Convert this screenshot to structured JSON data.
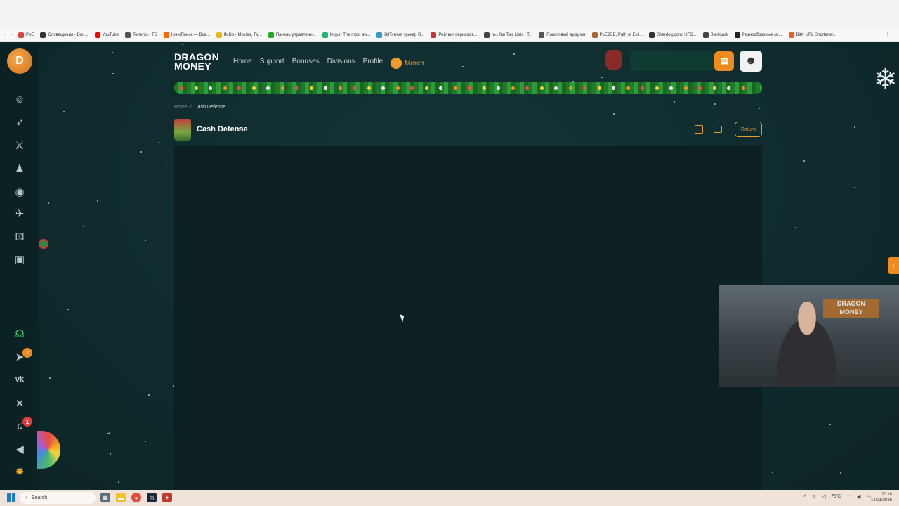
{
  "bookmarks": [
    {
      "label": "PoE",
      "color": "#d44"
    },
    {
      "label": "Оповещения - Don...",
      "color": "#333"
    },
    {
      "label": "YouTube",
      "color": "#f00"
    },
    {
      "label": "Torrents - TD",
      "color": "#555"
    },
    {
      "label": "КиноПоиск — Все...",
      "color": "#f60"
    },
    {
      "label": "IMDb - Movies, TV...",
      "color": "#e6b91e"
    },
    {
      "label": "Панель управлени...",
      "color": "#2a2"
    },
    {
      "label": "Imgur: The most aw...",
      "color": "#1bb76e"
    },
    {
      "label": "BitTorrent трекер R...",
      "color": "#39c"
    },
    {
      "label": "Рейтинг сериалов...",
      "color": "#c33"
    },
    {
      "label": "№1 fan Tier Lists - T...",
      "color": "#444"
    },
    {
      "label": "Политовый аукцион",
      "color": "#555"
    },
    {
      "label": "PoE2DB, Path of Exil...",
      "color": "#a63"
    },
    {
      "label": "Sherdog.com: UFC...",
      "color": "#333"
    },
    {
      "label": "Blackjack",
      "color": "#444"
    },
    {
      "label": "Разнообразные си...",
      "color": "#222"
    },
    {
      "label": "Bitly URL Shortener...",
      "color": "#ee6123"
    }
  ],
  "header": {
    "logo_line1": "DRAGON",
    "logo_line2": "MONEY",
    "nav": [
      "Home",
      "Support",
      "Bonuses",
      "Divisions",
      "Profile"
    ],
    "merch": "Merch",
    "wallet_icon": "wallet-icon",
    "avatar_icon": "avatar-icon"
  },
  "breadcrumb": {
    "home": "Home",
    "separator": "/",
    "current": "Cash Defense"
  },
  "game": {
    "title": "Cash Defense",
    "return_label": "Return"
  },
  "sidebar": {
    "icons": [
      "smile-icon",
      "rocket-icon",
      "crossed-swords-icon",
      "person-icon",
      "fire-icon",
      "plane-icon",
      "dice-icon",
      "gift-icon",
      "headset-icon",
      "telegram-icon",
      "vk-icon",
      "x-icon",
      "bell-icon",
      "volume-icon",
      "lightbulb-icon"
    ],
    "telegram_badge": "7",
    "bell_badge": "1"
  },
  "webcam": {
    "sign_line1": "DRAGON",
    "sign_line2": "MONEY"
  },
  "taskbar": {
    "search_placeholder": "Search",
    "language": "РУС",
    "time": "20:18",
    "date": "14/01/2026"
  },
  "colors": {
    "accent": "#f19a2a",
    "bg": "#0f2a2c",
    "rail": "#0b2224"
  }
}
